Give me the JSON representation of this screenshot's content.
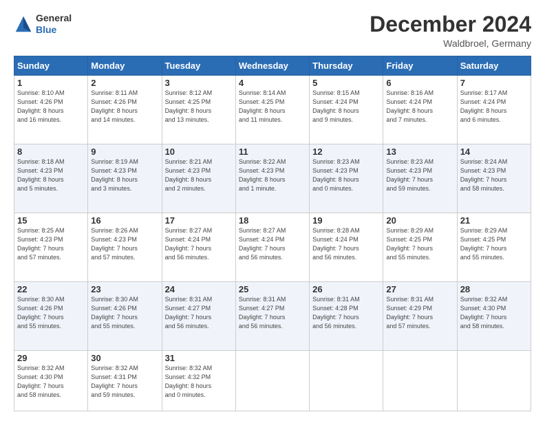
{
  "header": {
    "logo_line1": "General",
    "logo_line2": "Blue",
    "month": "December 2024",
    "location": "Waldbroel, Germany"
  },
  "weekdays": [
    "Sunday",
    "Monday",
    "Tuesday",
    "Wednesday",
    "Thursday",
    "Friday",
    "Saturday"
  ],
  "weeks": [
    [
      {
        "day": "1",
        "info": "Sunrise: 8:10 AM\nSunset: 4:26 PM\nDaylight: 8 hours\nand 16 minutes."
      },
      {
        "day": "2",
        "info": "Sunrise: 8:11 AM\nSunset: 4:26 PM\nDaylight: 8 hours\nand 14 minutes."
      },
      {
        "day": "3",
        "info": "Sunrise: 8:12 AM\nSunset: 4:25 PM\nDaylight: 8 hours\nand 13 minutes."
      },
      {
        "day": "4",
        "info": "Sunrise: 8:14 AM\nSunset: 4:25 PM\nDaylight: 8 hours\nand 11 minutes."
      },
      {
        "day": "5",
        "info": "Sunrise: 8:15 AM\nSunset: 4:24 PM\nDaylight: 8 hours\nand 9 minutes."
      },
      {
        "day": "6",
        "info": "Sunrise: 8:16 AM\nSunset: 4:24 PM\nDaylight: 8 hours\nand 7 minutes."
      },
      {
        "day": "7",
        "info": "Sunrise: 8:17 AM\nSunset: 4:24 PM\nDaylight: 8 hours\nand 6 minutes."
      }
    ],
    [
      {
        "day": "8",
        "info": "Sunrise: 8:18 AM\nSunset: 4:23 PM\nDaylight: 8 hours\nand 5 minutes."
      },
      {
        "day": "9",
        "info": "Sunrise: 8:19 AM\nSunset: 4:23 PM\nDaylight: 8 hours\nand 3 minutes."
      },
      {
        "day": "10",
        "info": "Sunrise: 8:21 AM\nSunset: 4:23 PM\nDaylight: 8 hours\nand 2 minutes."
      },
      {
        "day": "11",
        "info": "Sunrise: 8:22 AM\nSunset: 4:23 PM\nDaylight: 8 hours\nand 1 minute."
      },
      {
        "day": "12",
        "info": "Sunrise: 8:23 AM\nSunset: 4:23 PM\nDaylight: 8 hours\nand 0 minutes."
      },
      {
        "day": "13",
        "info": "Sunrise: 8:23 AM\nSunset: 4:23 PM\nDaylight: 7 hours\nand 59 minutes."
      },
      {
        "day": "14",
        "info": "Sunrise: 8:24 AM\nSunset: 4:23 PM\nDaylight: 7 hours\nand 58 minutes."
      }
    ],
    [
      {
        "day": "15",
        "info": "Sunrise: 8:25 AM\nSunset: 4:23 PM\nDaylight: 7 hours\nand 57 minutes."
      },
      {
        "day": "16",
        "info": "Sunrise: 8:26 AM\nSunset: 4:23 PM\nDaylight: 7 hours\nand 57 minutes."
      },
      {
        "day": "17",
        "info": "Sunrise: 8:27 AM\nSunset: 4:24 PM\nDaylight: 7 hours\nand 56 minutes."
      },
      {
        "day": "18",
        "info": "Sunrise: 8:27 AM\nSunset: 4:24 PM\nDaylight: 7 hours\nand 56 minutes."
      },
      {
        "day": "19",
        "info": "Sunrise: 8:28 AM\nSunset: 4:24 PM\nDaylight: 7 hours\nand 56 minutes."
      },
      {
        "day": "20",
        "info": "Sunrise: 8:29 AM\nSunset: 4:25 PM\nDaylight: 7 hours\nand 55 minutes."
      },
      {
        "day": "21",
        "info": "Sunrise: 8:29 AM\nSunset: 4:25 PM\nDaylight: 7 hours\nand 55 minutes."
      }
    ],
    [
      {
        "day": "22",
        "info": "Sunrise: 8:30 AM\nSunset: 4:26 PM\nDaylight: 7 hours\nand 55 minutes."
      },
      {
        "day": "23",
        "info": "Sunrise: 8:30 AM\nSunset: 4:26 PM\nDaylight: 7 hours\nand 55 minutes."
      },
      {
        "day": "24",
        "info": "Sunrise: 8:31 AM\nSunset: 4:27 PM\nDaylight: 7 hours\nand 56 minutes."
      },
      {
        "day": "25",
        "info": "Sunrise: 8:31 AM\nSunset: 4:27 PM\nDaylight: 7 hours\nand 56 minutes."
      },
      {
        "day": "26",
        "info": "Sunrise: 8:31 AM\nSunset: 4:28 PM\nDaylight: 7 hours\nand 56 minutes."
      },
      {
        "day": "27",
        "info": "Sunrise: 8:31 AM\nSunset: 4:29 PM\nDaylight: 7 hours\nand 57 minutes."
      },
      {
        "day": "28",
        "info": "Sunrise: 8:32 AM\nSunset: 4:30 PM\nDaylight: 7 hours\nand 58 minutes."
      }
    ],
    [
      {
        "day": "29",
        "info": "Sunrise: 8:32 AM\nSunset: 4:30 PM\nDaylight: 7 hours\nand 58 minutes."
      },
      {
        "day": "30",
        "info": "Sunrise: 8:32 AM\nSunset: 4:31 PM\nDaylight: 7 hours\nand 59 minutes."
      },
      {
        "day": "31",
        "info": "Sunrise: 8:32 AM\nSunset: 4:32 PM\nDaylight: 8 hours\nand 0 minutes."
      },
      {
        "day": "",
        "info": ""
      },
      {
        "day": "",
        "info": ""
      },
      {
        "day": "",
        "info": ""
      },
      {
        "day": "",
        "info": ""
      }
    ]
  ]
}
